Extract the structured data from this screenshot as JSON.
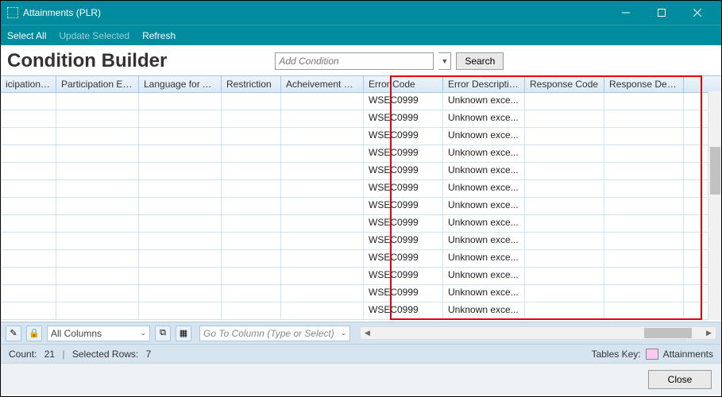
{
  "window": {
    "title": "Attainments (PLR)"
  },
  "menu": {
    "select_all": "Select All",
    "update_selected": "Update Selected",
    "refresh": "Refresh"
  },
  "builder": {
    "title": "Condition Builder",
    "add_condition_placeholder": "Add Condition",
    "search_label": "Search"
  },
  "columns": [
    "icipation St...",
    "Participation En...",
    "Language for A...",
    "Restriction",
    "Acheivement St...",
    "Error Code",
    "Error Description",
    "Response Code",
    "Response Desc..."
  ],
  "rows": [
    {
      "c0": "",
      "c1": "",
      "c2": "",
      "c3": "",
      "c4": "",
      "c5": "WSEC0999",
      "c6": "Unknown exce...",
      "c7": "",
      "c8": ""
    },
    {
      "c0": "",
      "c1": "",
      "c2": "",
      "c3": "",
      "c4": "",
      "c5": "WSEC0999",
      "c6": "Unknown exce...",
      "c7": "",
      "c8": ""
    },
    {
      "c0": "",
      "c1": "",
      "c2": "",
      "c3": "",
      "c4": "",
      "c5": "WSEC0999",
      "c6": "Unknown exce...",
      "c7": "",
      "c8": ""
    },
    {
      "c0": "",
      "c1": "",
      "c2": "",
      "c3": "",
      "c4": "",
      "c5": "WSEC0999",
      "c6": "Unknown exce...",
      "c7": "",
      "c8": ""
    },
    {
      "c0": "",
      "c1": "",
      "c2": "",
      "c3": "",
      "c4": "",
      "c5": "WSEC0999",
      "c6": "Unknown exce...",
      "c7": "",
      "c8": ""
    },
    {
      "c0": "",
      "c1": "",
      "c2": "",
      "c3": "",
      "c4": "",
      "c5": "WSEC0999",
      "c6": "Unknown exce...",
      "c7": "",
      "c8": ""
    },
    {
      "c0": "",
      "c1": "",
      "c2": "",
      "c3": "",
      "c4": "",
      "c5": "WSEC0999",
      "c6": "Unknown exce...",
      "c7": "",
      "c8": ""
    },
    {
      "c0": "",
      "c1": "",
      "c2": "",
      "c3": "",
      "c4": "",
      "c5": "WSEC0999",
      "c6": "Unknown exce...",
      "c7": "",
      "c8": ""
    },
    {
      "c0": "",
      "c1": "",
      "c2": "",
      "c3": "",
      "c4": "",
      "c5": "WSEC0999",
      "c6": "Unknown exce...",
      "c7": "",
      "c8": ""
    },
    {
      "c0": "",
      "c1": "",
      "c2": "",
      "c3": "",
      "c4": "",
      "c5": "WSEC0999",
      "c6": "Unknown exce...",
      "c7": "",
      "c8": ""
    },
    {
      "c0": "",
      "c1": "",
      "c2": "",
      "c3": "",
      "c4": "",
      "c5": "WSEC0999",
      "c6": "Unknown exce...",
      "c7": "",
      "c8": ""
    },
    {
      "c0": "",
      "c1": "",
      "c2": "",
      "c3": "",
      "c4": "",
      "c5": "WSEC0999",
      "c6": "Unknown exce...",
      "c7": "",
      "c8": ""
    },
    {
      "c0": "",
      "c1": "",
      "c2": "",
      "c3": "",
      "c4": "",
      "c5": "WSEC0999",
      "c6": "Unknown exce...",
      "c7": "",
      "c8": ""
    }
  ],
  "bottom": {
    "all_columns": "All Columns",
    "goto_placeholder": "Go To Column (Type or Select)"
  },
  "status": {
    "count_label": "Count:",
    "count_value": "21",
    "selected_label": "Selected Rows:",
    "selected_value": "7",
    "tables_key_label": "Tables Key:",
    "attainments_label": "Attainments"
  },
  "footer": {
    "close_label": "Close"
  }
}
